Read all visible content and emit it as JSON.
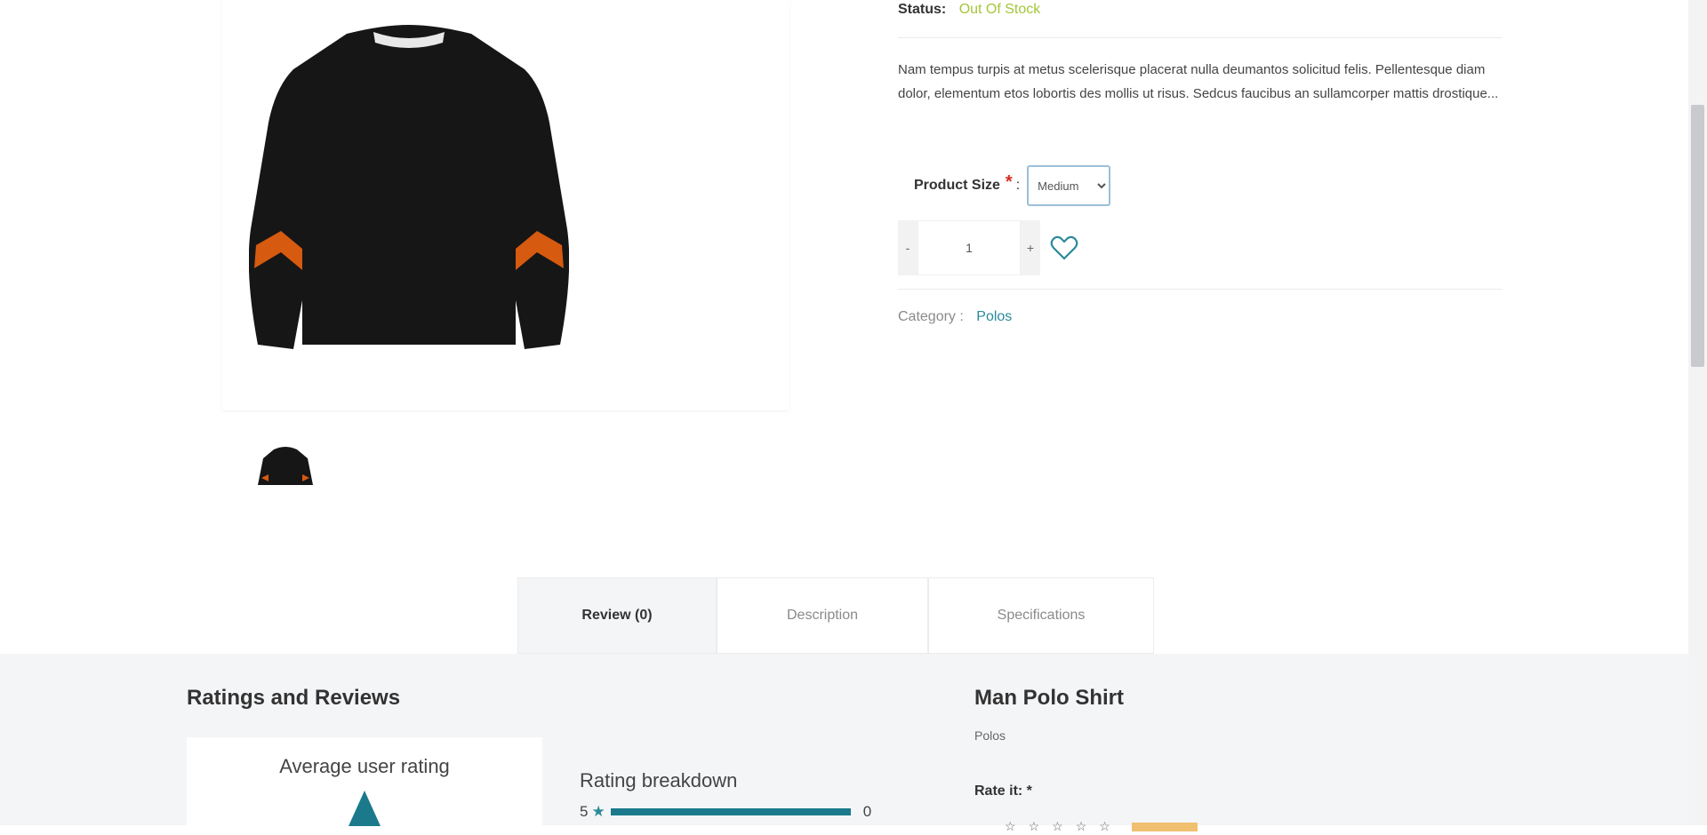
{
  "product": {
    "status_label": "Status:",
    "status_value": "Out Of Stock",
    "description": "Nam tempus turpis at metus scelerisque placerat nulla deumantos solicitud felis. Pellentesque diam dolor, elementum etos lobortis des mollis ut risus. Sedcus faucibus an sullamcorper mattis drostique...",
    "size_label": "Product Size",
    "size_required_mark": "*",
    "size_selected": "Medium",
    "quantity": "1",
    "qty_minus": "-",
    "qty_plus": "+",
    "category_label": "Category :",
    "category_value": "Polos"
  },
  "tabs": [
    {
      "label": "Review (0)",
      "active": true
    },
    {
      "label": "Description",
      "active": false
    },
    {
      "label": "Specifications",
      "active": false
    }
  ],
  "reviews": {
    "title": "Ratings and Reviews",
    "average_title": "Average user rating",
    "breakdown_title": "Rating breakdown",
    "breakdown": [
      {
        "stars": "5",
        "count": "0"
      }
    ]
  },
  "review_form": {
    "product_name": "Man Polo Shirt",
    "category": "Polos",
    "rate_label": "Rate it: *"
  },
  "colors": {
    "status": "#a4c639",
    "accent": "#2a8a99",
    "bar": "#1a7a8c",
    "sweater": "#161616",
    "sweater_stripe": "#d65a10"
  },
  "icons": [
    "heart-icon",
    "star-icon",
    "chevron-down-icon"
  ]
}
